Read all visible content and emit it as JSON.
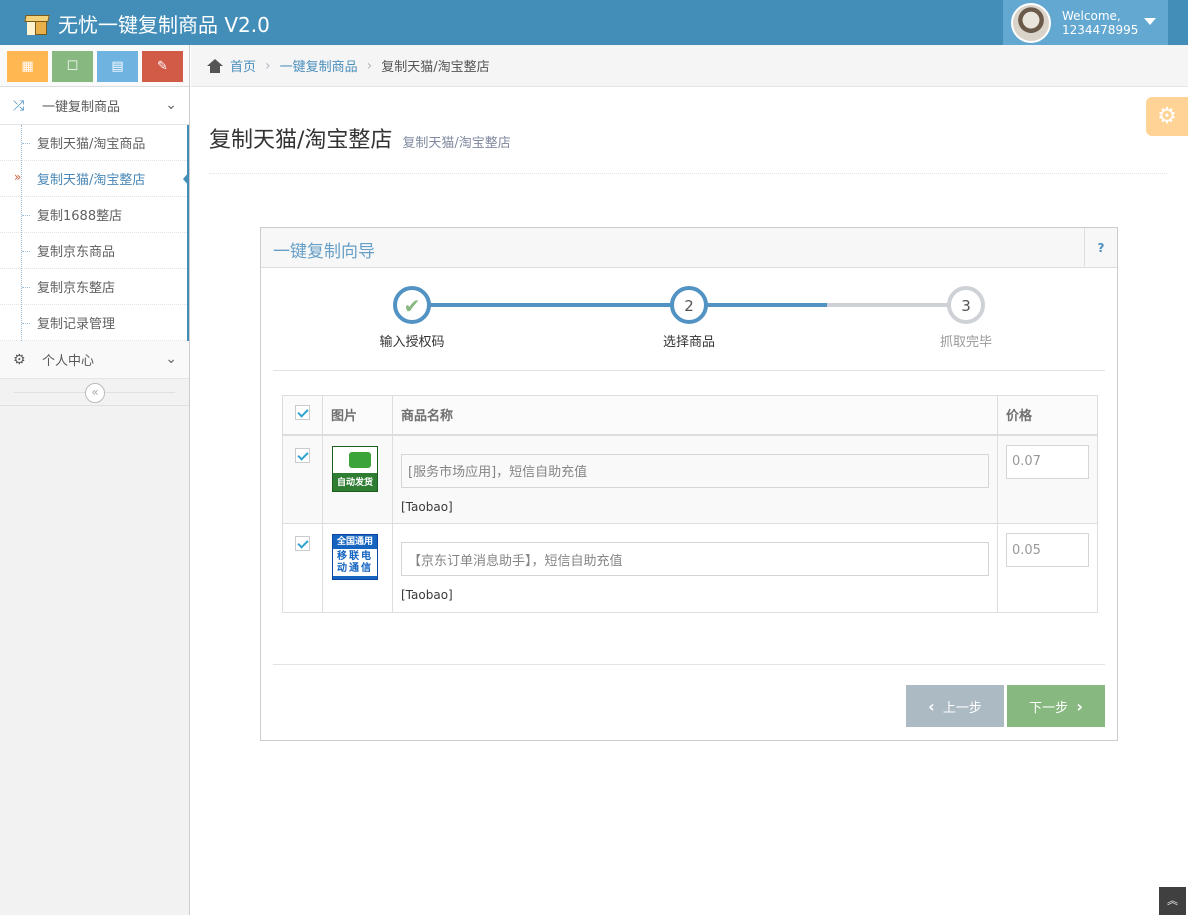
{
  "app": {
    "title": "无忧一键复制商品 V2.0"
  },
  "user": {
    "welcome": "Welcome,",
    "name": "1234478995"
  },
  "shortcuts": [
    {
      "icon": "calendar-icon",
      "glyph": "▦"
    },
    {
      "icon": "square-icon",
      "glyph": "☐"
    },
    {
      "icon": "grid-icon",
      "glyph": "▦"
    },
    {
      "icon": "book-icon",
      "glyph": "✎"
    }
  ],
  "sidebar": {
    "section1": {
      "label": "一键复制商品",
      "icon": "shuffle-icon"
    },
    "items": [
      {
        "label": "复制天猫/淘宝商品"
      },
      {
        "label": "复制天猫/淘宝整店"
      },
      {
        "label": "复制1688整店"
      },
      {
        "label": "复制京东商品"
      },
      {
        "label": "复制京东整店"
      },
      {
        "label": "复制记录管理"
      }
    ],
    "active_index": 1,
    "section2": {
      "label": "个人中心",
      "icon": "gear-icon"
    }
  },
  "breadcrumb": {
    "home": "首页",
    "section": "一键复制商品",
    "current": "复制天猫/淘宝整店"
  },
  "page": {
    "title": "复制天猫/淘宝整店",
    "subtitle": "复制天猫/淘宝整店"
  },
  "wizard": {
    "title": "一键复制向导",
    "help": "?",
    "steps": [
      {
        "number": "✔",
        "label": "输入授权码",
        "state": "done"
      },
      {
        "number": "2",
        "label": "选择商品",
        "state": "current"
      },
      {
        "number": "3",
        "label": "抓取完毕",
        "state": "todo"
      }
    ]
  },
  "table": {
    "headers": {
      "image": "图片",
      "name": "商品名称",
      "price": "价格"
    },
    "rows": [
      {
        "checked": true,
        "thumb": "自动发货",
        "name": "[服务市场应用]，短信自助充值",
        "source": "[Taobao]",
        "price": "0.07"
      },
      {
        "checked": true,
        "thumb_band": "全国通用",
        "thumb_body": "移联电 动通信",
        "name": "【京东订单消息助手】，短信自助充值",
        "source": "[Taobao]",
        "price": "0.05"
      }
    ]
  },
  "actions": {
    "prev": "上一步",
    "next": "下一步"
  },
  "colors": {
    "navbar": "#438eb9",
    "accent": "#5293c4",
    "prev_btn": "#abbac3",
    "next_btn": "#87b87f"
  }
}
